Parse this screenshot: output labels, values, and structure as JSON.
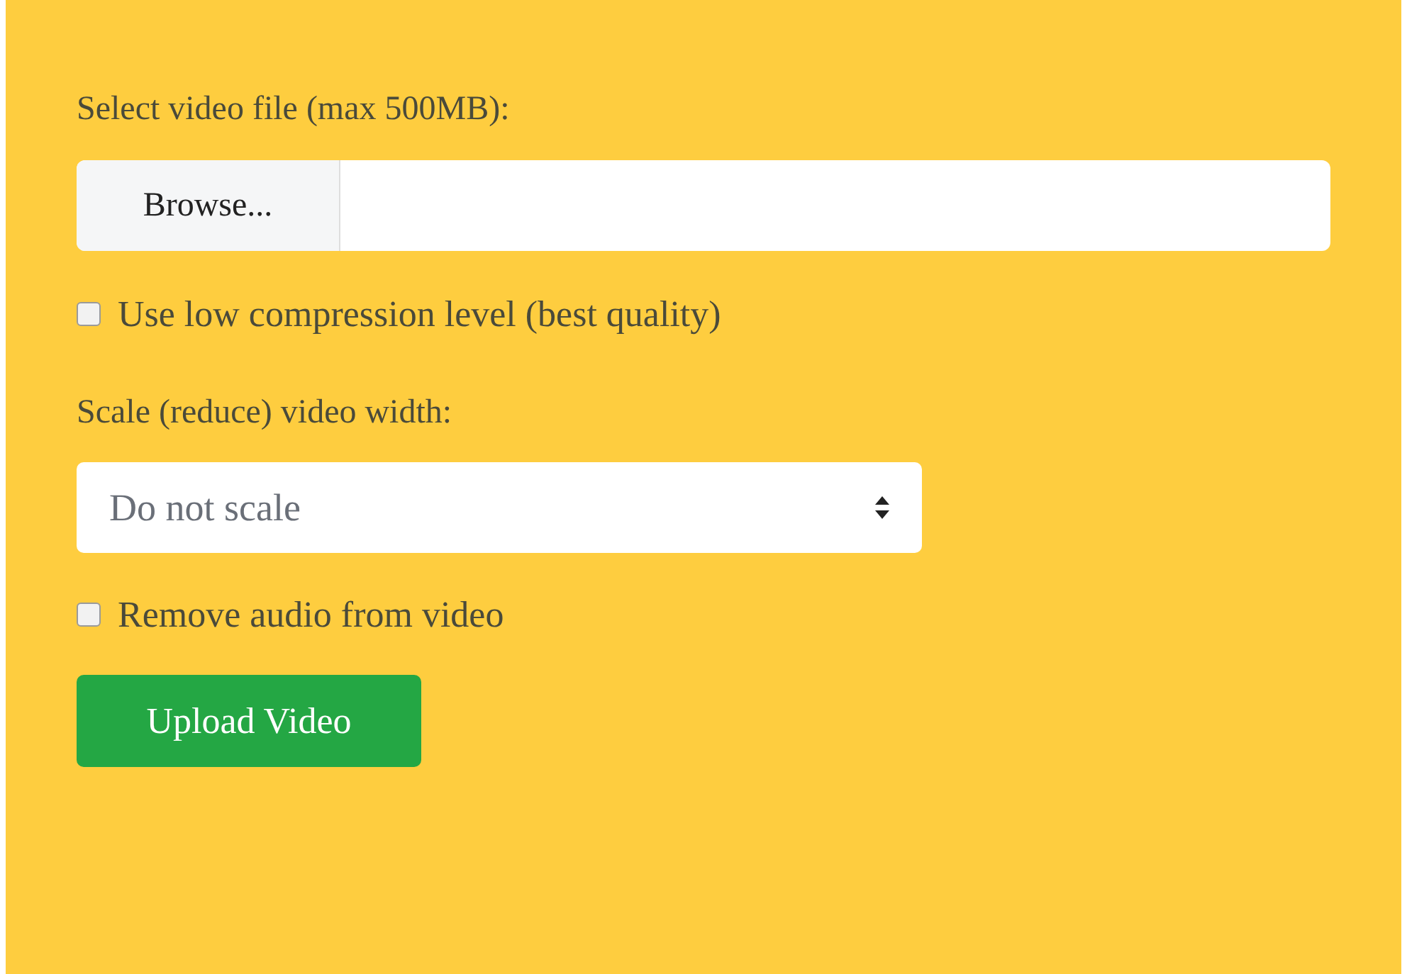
{
  "form": [
    {
      "kind": "label",
      "text": "Select video file (max 500MB):"
    },
    {
      "kind": "file",
      "button": "Browse..."
    },
    {
      "kind": "checkbox",
      "label": "Use low compression level (best quality)",
      "checked": false
    },
    {
      "kind": "label",
      "text": "Scale (reduce) video width:"
    },
    {
      "kind": "select",
      "value": "Do not scale"
    },
    {
      "kind": "checkbox",
      "label": "Remove audio from video",
      "checked": false
    },
    {
      "kind": "button",
      "label": "Upload Video"
    }
  ]
}
